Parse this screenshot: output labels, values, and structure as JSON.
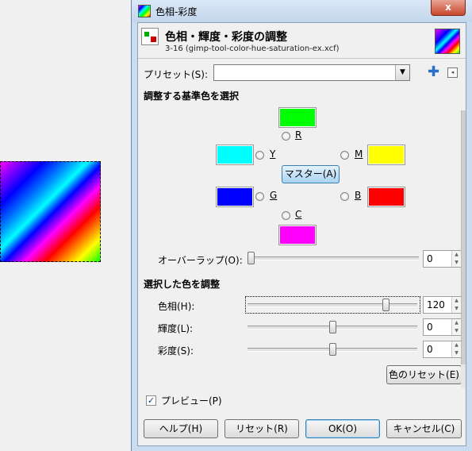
{
  "window": {
    "title": "色相-彩度",
    "close_label": "x"
  },
  "header": {
    "title": "色相・輝度・彩度の調整",
    "subtitle": "3-16 (gimp-tool-color-hue-saturation-ex.xcf)"
  },
  "preset": {
    "label": "プリセット(S):",
    "value": ""
  },
  "primary_section": {
    "label": "調整する基準色を選択",
    "colors": {
      "R": {
        "label": "R",
        "color": "#00ff00"
      },
      "Y": {
        "label": "Y",
        "color": "#00ffff"
      },
      "M": {
        "label": "M",
        "color": "#ffff00"
      },
      "G": {
        "label": "G",
        "color": "#0000ff"
      },
      "B": {
        "label": "B",
        "color": "#ff0000"
      },
      "C": {
        "label": "C",
        "color": "#ff00ff"
      }
    },
    "master_button": "マスター(A)"
  },
  "overlap": {
    "label": "オーバーラップ(O):",
    "value": "0",
    "level": 0
  },
  "adjust_section": {
    "label": "選択した色を調整",
    "hue": {
      "label": "色相(H):",
      "value": "120",
      "level": 0.83
    },
    "lightness": {
      "label": "輝度(L):",
      "value": "0",
      "level": 0.5
    },
    "saturation": {
      "label": "彩度(S):",
      "value": "0",
      "level": 0.5
    },
    "reset_color_button": "色のリセット(E)"
  },
  "preview": {
    "label": "プレビュー(P)",
    "checked": true
  },
  "buttons": {
    "help": "ヘルプ(H)",
    "reset": "リセット(R)",
    "ok": "OK(O)",
    "cancel": "キャンセル(C)"
  }
}
